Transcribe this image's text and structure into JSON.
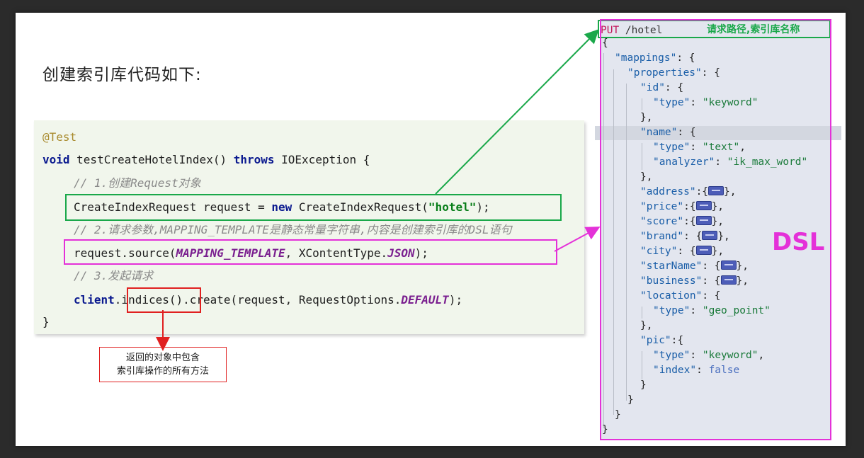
{
  "heading": "创建索引库代码如下:",
  "code": {
    "l1": "@Test",
    "l2_kw1": "void",
    "l2_name": " testCreateHotelIndex() ",
    "l2_kw2": "throws",
    "l2_rest": " IOException {",
    "l3": "// 1.创建Request对象",
    "l4_a": "CreateIndexRequest request = ",
    "l4_kw": "new",
    "l4_b": " CreateIndexRequest(",
    "l4_str": "\"hotel\"",
    "l4_c": ");",
    "l5": "// 2.请求参数,MAPPING_TEMPLATE是静态常量字符串,内容是创建索引库的DSL语句",
    "l6_a": "request.source(",
    "l6_const": "MAPPING_TEMPLATE",
    "l6_b": ", XContentType.",
    "l6_const2": "JSON",
    "l6_c": ");",
    "l7": "// 3.发起请求",
    "l8_field": "client",
    "l8_a": ".indices().create(request, RequestOptions.",
    "l8_const": "DEFAULT",
    "l8_c": ");",
    "l9": "}"
  },
  "callout": {
    "line1": "返回的对象中包含",
    "line2": "索引库操作的所有方法"
  },
  "dsl": {
    "put_method": "PUT",
    "put_path": " /hotel",
    "path_label": "请求路径,索引库名称",
    "label": "DSL",
    "lines": {
      "open": "{",
      "mappings": "\"mappings\"",
      "properties": "\"properties\"",
      "id": "\"id\"",
      "type": "\"type\"",
      "keyword": "\"keyword\"",
      "name": "\"name\"",
      "text": "\"text\"",
      "analyzer": "\"analyzer\"",
      "ik_max_word": "\"ik_max_word\"",
      "address": "\"address\"",
      "price": "\"price\"",
      "score": "\"score\"",
      "brand": "\"brand\"",
      "city": "\"city\"",
      "starName": "\"starName\"",
      "business": "\"business\"",
      "location": "\"location\"",
      "geo_point": "\"geo_point\"",
      "pic": "\"pic\"",
      "index": "\"index\"",
      "false": "false"
    }
  },
  "colors": {
    "green_box": "#1aa84a",
    "magenta_box": "#e431d8",
    "red_box": "#e02020"
  }
}
